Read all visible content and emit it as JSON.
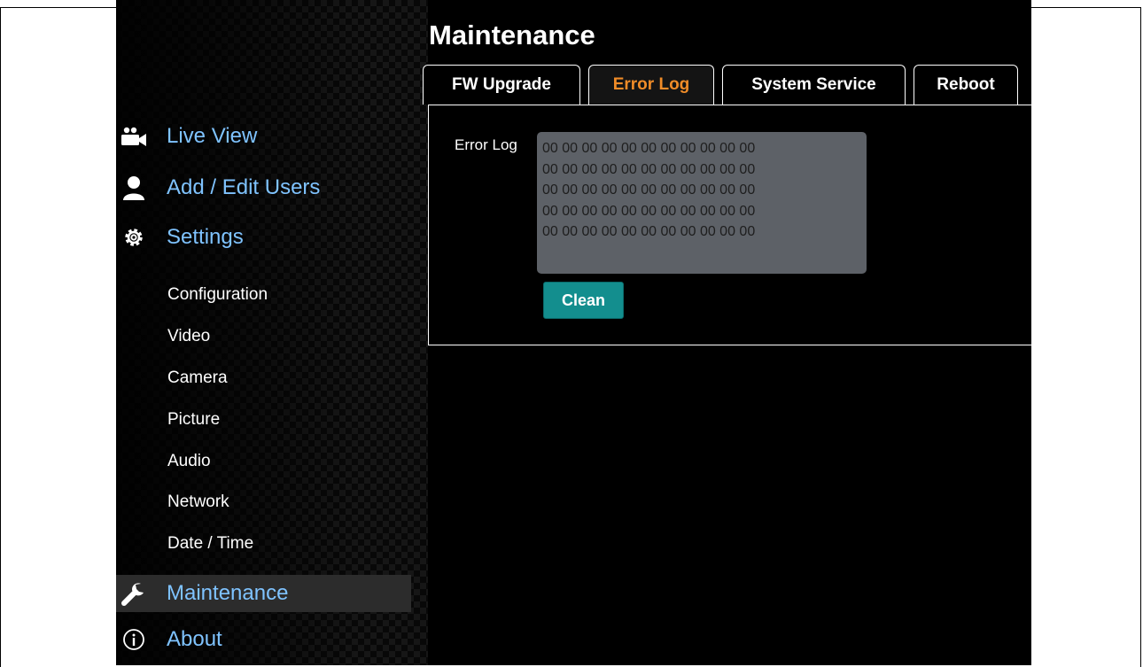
{
  "page": {
    "title": "Maintenance"
  },
  "sidebar": {
    "main_items": [
      {
        "label": "Live View",
        "icon": "video-camera-icon"
      },
      {
        "label": "Add / Edit Users",
        "icon": "user-icon"
      },
      {
        "label": "Settings",
        "icon": "gear-icon"
      },
      {
        "label": "Maintenance",
        "icon": "wrench-icon",
        "active": true
      },
      {
        "label": "About",
        "icon": "info-icon"
      }
    ],
    "settings_items": [
      {
        "label": "Configuration"
      },
      {
        "label": "Video"
      },
      {
        "label": "Camera"
      },
      {
        "label": "Picture"
      },
      {
        "label": "Audio"
      },
      {
        "label": "Network"
      },
      {
        "label": "Date / Time"
      }
    ]
  },
  "tabs": [
    {
      "label": "FW Upgrade"
    },
    {
      "label": "Error Log",
      "active": true
    },
    {
      "label": "System Service"
    },
    {
      "label": "Reboot"
    }
  ],
  "error_log": {
    "label": "Error Log",
    "lines": [
      "00 00 00 00 00 00 00 00 00 00 00",
      "00 00 00 00 00 00 00 00 00 00 00",
      "00 00 00 00 00 00 00 00 00 00 00",
      "00 00 00 00 00 00 00 00 00 00 00",
      "00 00 00 00 00 00 00 00 00 00 00"
    ],
    "clean_label": "Clean"
  },
  "colors": {
    "nav_link": "#7fc3ff",
    "active_tab": "#f08c28",
    "clean_button": "#138e8e",
    "log_box": "#5d6167"
  }
}
